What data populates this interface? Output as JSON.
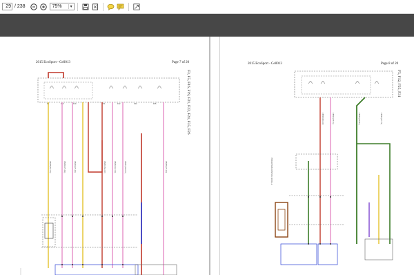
{
  "toolbar": {
    "page_current": "29",
    "page_total": "/ 238",
    "zoom": "75%",
    "icons": [
      "zoom-out-icon",
      "zoom-in-icon",
      "zoom-dropdown-icon",
      "save-icon",
      "fit-page-icon",
      "comment-icon",
      "highlight-icon",
      "fullscreen-icon"
    ]
  },
  "pages": {
    "left": {
      "title": "2015 EcoSport - Cell013",
      "page_label": "Page 7 of 20",
      "fuse_label": "F3, F5, F16, F19, F21, F22, F24, F35, F26"
    },
    "right": {
      "title": "2015 EcoSport - Cell013",
      "page_label": "Page 8 of 20",
      "fuse_label": "F5, F12, F25, F31"
    }
  },
  "colors": {
    "band": "#474747",
    "wire_red": "#c0392b",
    "wire_pink": "#e58fc7",
    "wire_yellow": "#e3c22b",
    "wire_violet": "#8e5bd6",
    "wire_green": "#3e7d2a",
    "wire_brown": "#8b4513",
    "wire_blue": "#2b3fd6"
  }
}
